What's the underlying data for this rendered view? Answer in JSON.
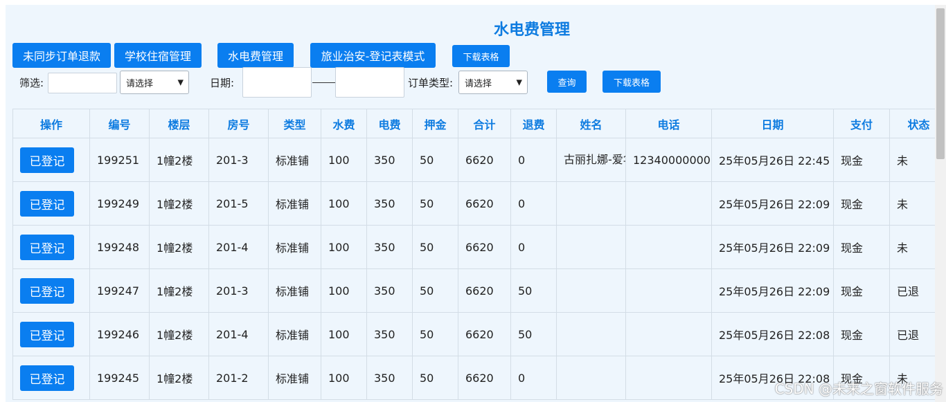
{
  "page_title": "水电费管理",
  "top_buttons": [
    "未同步订单退款",
    "学校住宿管理",
    "水电费管理",
    "旅业治安-登记表模式",
    "下载表格"
  ],
  "filter": {
    "filter_label": "筛选:",
    "select_placeholder": "请选择",
    "date_label": "日期:",
    "order_type_label": "订单类型:",
    "query_button": "查询",
    "download_button": "下载表格"
  },
  "columns": [
    "操作",
    "编号",
    "楼层",
    "房号",
    "类型",
    "水费",
    "电费",
    "押金",
    "合计",
    "退费",
    "姓名",
    "电话",
    "日期",
    "支付",
    "状态"
  ],
  "rows": [
    {
      "action": "已登记",
      "id": "199251",
      "floor": "1幢2楼",
      "room": "201-3",
      "type": "标准铺",
      "water": "100",
      "electric": "350",
      "deposit": "50",
      "total": "6620",
      "refund": "0",
      "name": "古丽扎娜-爱华",
      "phone": "12340000000",
      "date": "25年05月26日 22:45",
      "pay": "现金",
      "status": "未"
    },
    {
      "action": "已登记",
      "id": "199249",
      "floor": "1幢2楼",
      "room": "201-5",
      "type": "标准铺",
      "water": "100",
      "electric": "350",
      "deposit": "50",
      "total": "6620",
      "refund": "0",
      "name": "",
      "phone": "",
      "date": "25年05月26日 22:09",
      "pay": "现金",
      "status": "未"
    },
    {
      "action": "已登记",
      "id": "199248",
      "floor": "1幢2楼",
      "room": "201-4",
      "type": "标准铺",
      "water": "100",
      "electric": "350",
      "deposit": "50",
      "total": "6620",
      "refund": "0",
      "name": "",
      "phone": "",
      "date": "25年05月26日 22:09",
      "pay": "现金",
      "status": "未"
    },
    {
      "action": "已登记",
      "id": "199247",
      "floor": "1幢2楼",
      "room": "201-3",
      "type": "标准铺",
      "water": "100",
      "electric": "350",
      "deposit": "50",
      "total": "6620",
      "refund": "50",
      "name": "",
      "phone": "",
      "date": "25年05月26日 22:09",
      "pay": "现金",
      "status": "已退"
    },
    {
      "action": "已登记",
      "id": "199246",
      "floor": "1幢2楼",
      "room": "201-4",
      "type": "标准铺",
      "water": "100",
      "electric": "350",
      "deposit": "50",
      "total": "6620",
      "refund": "50",
      "name": "",
      "phone": "",
      "date": "25年05月26日 22:08",
      "pay": "现金",
      "status": "已退"
    },
    {
      "action": "已登记",
      "id": "199245",
      "floor": "1幢2楼",
      "room": "201-2",
      "type": "标准铺",
      "water": "100",
      "electric": "350",
      "deposit": "50",
      "total": "6620",
      "refund": "0",
      "name": "",
      "phone": "",
      "date": "25年05月26日 22:08",
      "pay": "现金",
      "status": "未"
    }
  ],
  "watermark": "CSDN @未来之窗软件服务",
  "colors": {
    "accent": "#0a7ef0",
    "title": "#0d7be0",
    "room": "#e41414",
    "panel_bg": "#eef6fd"
  }
}
